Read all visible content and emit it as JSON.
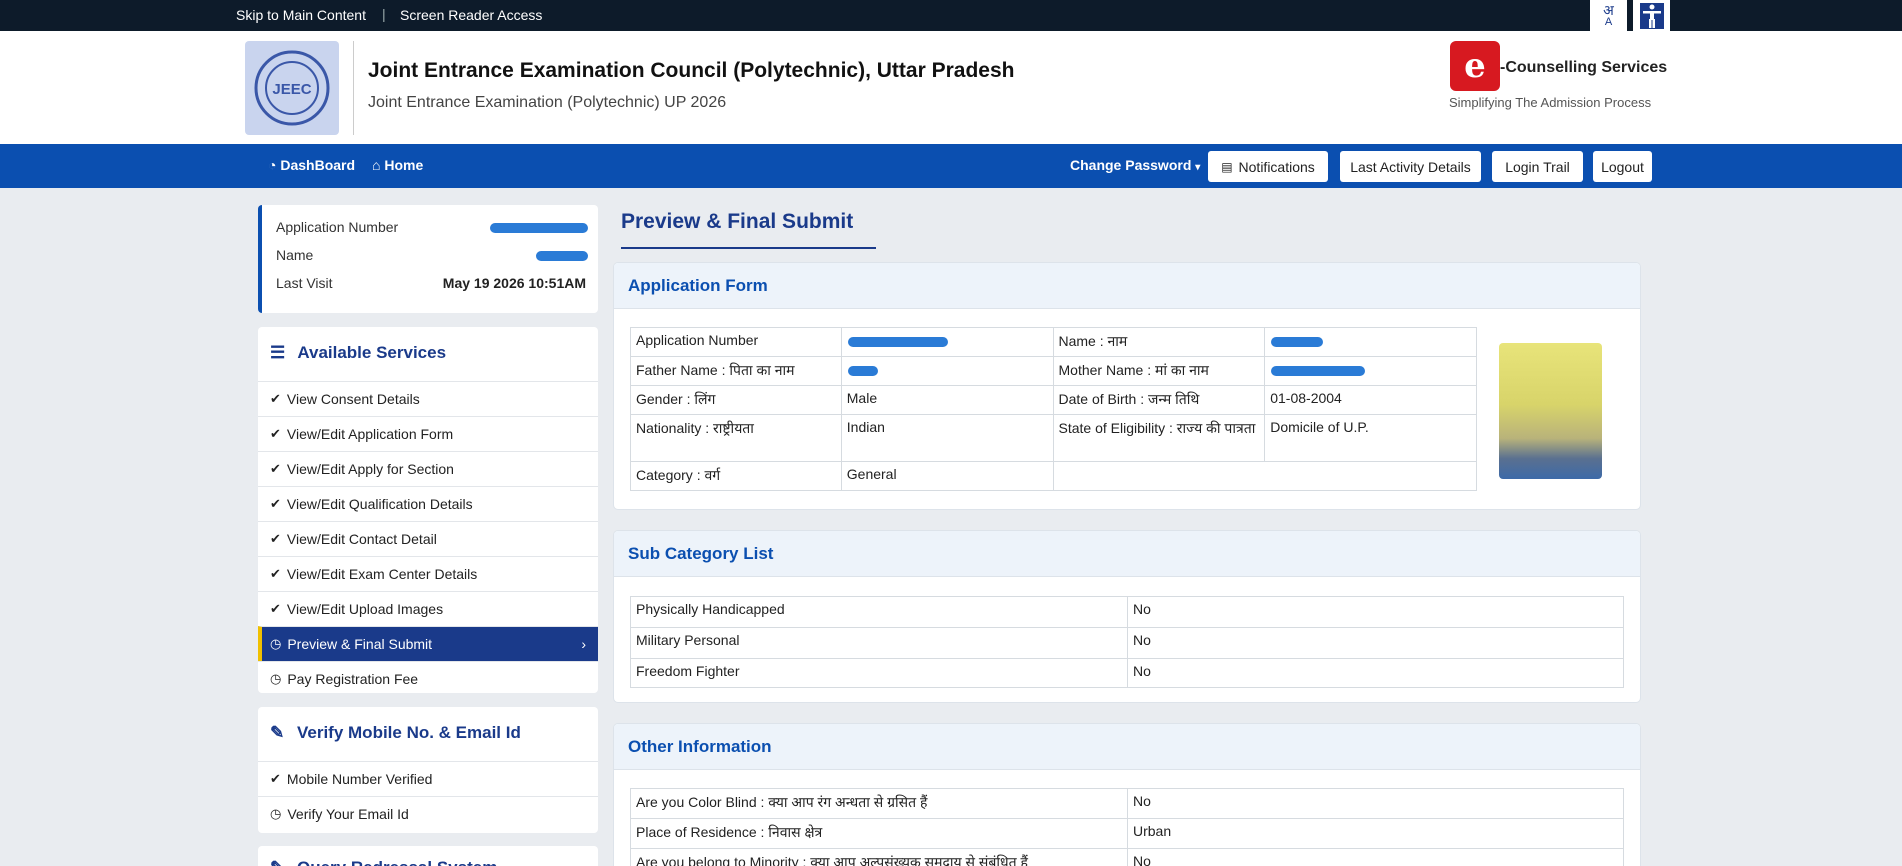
{
  "topbar": {
    "skip_label": "Skip to Main Content",
    "sep": "|",
    "screen_reader_label": "Screen Reader Access",
    "lang_glyph_1": "अ",
    "lang_glyph_2": "A"
  },
  "header": {
    "title": "Joint Entrance Examination Council (Polytechnic), Uttar Pradesh",
    "subtitle": "Joint Entrance Examination (Polytechnic) UP 2026",
    "logo_text": "JEEC",
    "ec_logo_glyph": "e",
    "ec_name": "-Counselling Services",
    "ec_tagline": "Simplifying The Admission Process"
  },
  "nav": {
    "dashboard": "DashBoard",
    "home": "Home",
    "change_password": "Change Password",
    "notifications": "Notifications",
    "last_activity": "Last Activity Details",
    "login_trail": "Login Trail",
    "logout": "Logout"
  },
  "userinfo": {
    "app_no_label": "Application Number",
    "name_label": "Name",
    "last_visit_label": "Last Visit",
    "last_visit_value": "May 19 2026 10:51AM"
  },
  "services": {
    "heading": "Available Services",
    "items": [
      {
        "label": "View Consent Details",
        "icon": "check-circle"
      },
      {
        "label": "View/Edit Application Form",
        "icon": "check-circle"
      },
      {
        "label": "View/Edit Apply for Section",
        "icon": "check-circle"
      },
      {
        "label": "View/Edit Qualification Details",
        "icon": "check-circle"
      },
      {
        "label": "View/Edit Contact Detail",
        "icon": "check-circle"
      },
      {
        "label": "View/Edit Exam Center Details",
        "icon": "check-circle"
      },
      {
        "label": "View/Edit Upload Images",
        "icon": "check-circle"
      },
      {
        "label": "Preview & Final Submit",
        "icon": "clock"
      },
      {
        "label": "Pay Registration Fee",
        "icon": "clock"
      }
    ]
  },
  "verify": {
    "heading": "Verify Mobile No. & Email Id",
    "items": [
      {
        "label": "Mobile Number Verified",
        "icon": "check-circle"
      },
      {
        "label": "Verify Your Email Id",
        "icon": "clock"
      }
    ]
  },
  "query": {
    "heading": "Query Redressal System"
  },
  "main": {
    "page_title": "Preview & Final Submit",
    "application_form": {
      "heading": "Application Form",
      "app_no_label": "Application Number",
      "name_label": "Name : नाम",
      "father_label": "Father Name : पिता का नाम",
      "mother_label": "Mother Name : मां का नाम",
      "gender_label": "Gender : लिंग",
      "gender_value": "Male",
      "dob_label": "Date of Birth : जन्म तिथि",
      "dob_value": "01-08-2004",
      "nationality_label": "Nationality : राष्ट्रीयता",
      "nationality_value": "Indian",
      "state_label": "State of Eligibility : राज्य की पात्रता",
      "state_value": "Domicile of U.P.",
      "category_label": "Category : वर्ग",
      "category_value": "General"
    },
    "sub_category": {
      "heading": "Sub Category List",
      "rows": [
        {
          "label": "Physically Handicapped",
          "value": "No"
        },
        {
          "label": "Military Personal",
          "value": "No"
        },
        {
          "label": "Freedom Fighter",
          "value": "No"
        }
      ]
    },
    "other_info": {
      "heading": "Other Information",
      "rows": [
        {
          "label": "Are you Color Blind : क्या आप रंग अन्धता से ग्रसित हैं",
          "value": "No"
        },
        {
          "label": "Place of Residence : निवास क्षेत्र",
          "value": "Urban"
        },
        {
          "label": "Are you belong to Minority : क्या आप अल्पसंख्यक समुदाय से संबंधित हैं",
          "value": "No"
        }
      ]
    }
  }
}
